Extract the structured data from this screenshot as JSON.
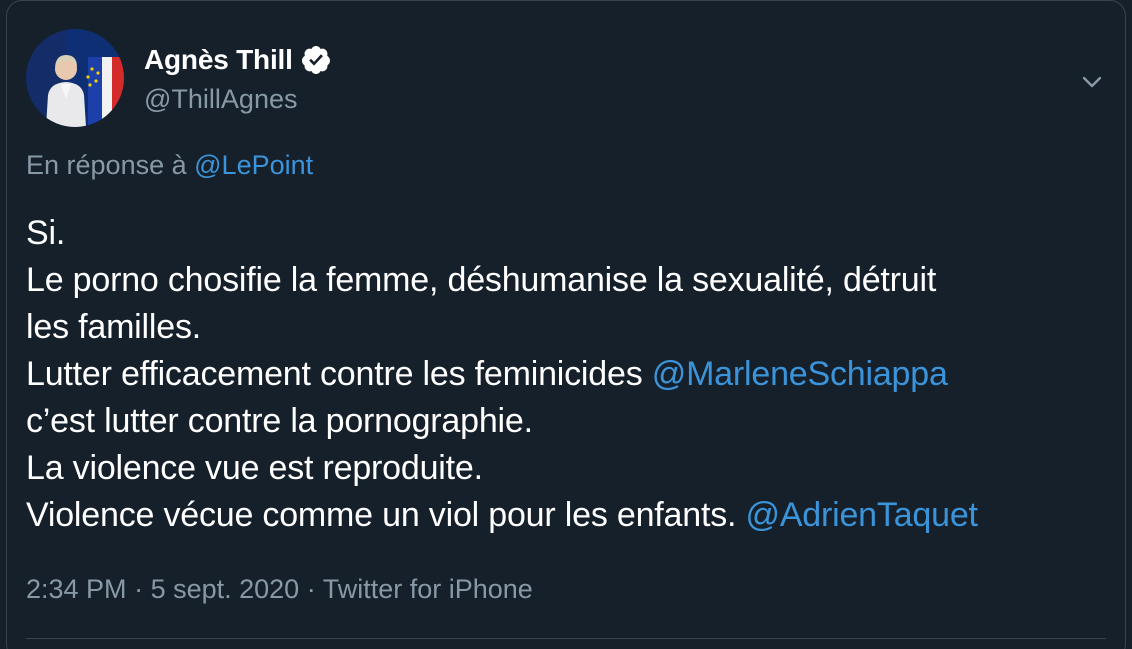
{
  "author": {
    "display_name": "Agnès Thill",
    "handle": "@ThillAgnes",
    "verified": true,
    "avatar_icon": "profile-photo"
  },
  "reply": {
    "prefix": "En réponse à",
    "mention": "@LePoint"
  },
  "tweet": {
    "line1": "Si.",
    "line2": "Le porno chosifie la femme, déshumanise la sexualité, détruit",
    "line3": "les familles.",
    "line4_text": "Lutter efficacement contre les feminicides ",
    "line4_mention": "@MarleneSchiappa",
    "line5": "c’est lutter contre la pornographie.",
    "line6": "La violence vue est reproduite.",
    "line7_text": "Violence vécue comme un viol pour les enfants. ",
    "line7_mention": "@AdrienTaquet"
  },
  "meta": {
    "time": "2:34 PM",
    "separator": " · ",
    "date": "5 sept. 2020",
    "source": "Twitter for iPhone"
  },
  "icons": {
    "verified": "verified-badge-icon",
    "menu": "chevron-down-icon"
  },
  "colors": {
    "background": "#15202b",
    "link": "#3b94d9",
    "secondary_text": "#8899a6",
    "border": "#38444d"
  }
}
